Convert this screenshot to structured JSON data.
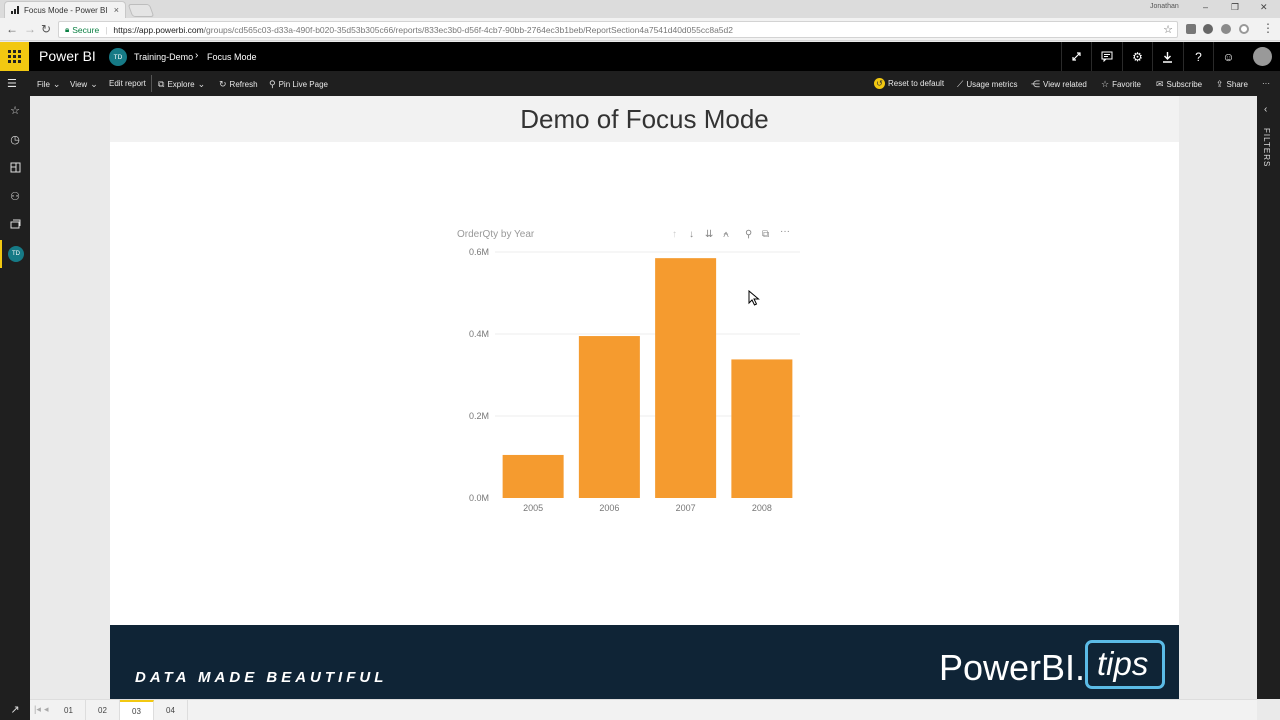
{
  "browser": {
    "tab_title": "Focus Mode - Power BI",
    "tab_close": "×",
    "window_user": "Jonathan",
    "window_controls": {
      "minimize": "–",
      "restore": "❐",
      "close": "✕"
    },
    "nav": {
      "back": "←",
      "forward": "→",
      "reload": "↻"
    },
    "security_label": "Secure",
    "url_host": "https://app.powerbi.com",
    "url_path": "/groups/cd565c03-d33a-490f-b020-35d53b305c66/reports/833ec3b0-d56f-4cb7-90bb-2764ec3b1beb/ReportSection4a7541d40d055cc8a5d2",
    "bookmark_star": "☆",
    "menu_dots": "⋮"
  },
  "pbi_header": {
    "brand": "Power BI",
    "workspace_initials": "TD",
    "workspace_name": "Training-Demo",
    "breadcrumb_separator": "›",
    "report_name": "Focus Mode",
    "icons": [
      "fullscreen-icon",
      "comment-icon",
      "settings-icon",
      "download-icon",
      "help-icon",
      "feedback-icon",
      "user-avatar"
    ]
  },
  "actionbar": {
    "file": "File",
    "view": "View",
    "edit_report": "Edit report",
    "explore": "Explore",
    "refresh": "Refresh",
    "pin_live_page": "Pin Live Page",
    "reset_to_default": "Reset to default",
    "usage_metrics": "Usage metrics",
    "view_related": "View related",
    "favorite": "Favorite",
    "subscribe": "Subscribe",
    "share": "Share",
    "more": "···"
  },
  "leftnav": {
    "workspace_initials": "TD",
    "items": [
      "hamburger-icon",
      "favorites-icon",
      "recent-icon",
      "apps-icon",
      "shared-icon",
      "workspaces-icon",
      "workspace-avatar"
    ]
  },
  "filters_pane": {
    "label": "FILTERS",
    "chevron": "‹"
  },
  "report": {
    "title": "Demo of Focus Mode",
    "footer_tagline": "DATA MADE BEAUTIFUL",
    "footer_logo_main": "PowerBI.",
    "footer_logo_tips": "tips"
  },
  "chart_data": {
    "type": "bar",
    "title": "OrderQty by Year",
    "categories": [
      "2005",
      "2006",
      "2007",
      "2008"
    ],
    "values": [
      0.105,
      0.395,
      0.585,
      0.338
    ],
    "value_unit": "M",
    "ylim": [
      0,
      0.6
    ],
    "yticks": [
      "0.0M",
      "0.2M",
      "0.4M",
      "0.6M"
    ],
    "bar_color": "#f59b2f",
    "grid": true,
    "header_icons": [
      "drill-up-icon",
      "drill-down-icon",
      "expand-next-level-icon",
      "expand-hierarchy-icon",
      "pin-visual-icon",
      "focus-mode-icon",
      "more-options-icon"
    ]
  },
  "page_tabs": {
    "first": "|◂",
    "prev": "◂",
    "tabs": [
      "01",
      "02",
      "03",
      "04"
    ],
    "active_index": 2
  },
  "colors": {
    "accent_yellow": "#f2c811",
    "footer_navy": "#0f2436",
    "workspace_teal": "#167a86"
  }
}
